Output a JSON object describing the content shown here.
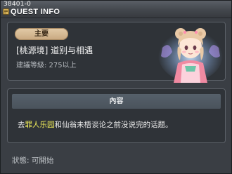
{
  "header": {
    "quest_id": "38401-0",
    "title": "QUEST INFO",
    "icon": "quest-book-icon"
  },
  "quest": {
    "type_label": "主要",
    "name": "[桃源境] 道别与相遇",
    "level_requirement": "建議等級: 275以上",
    "npc": "npc-portrait-girl-with-bun-hair"
  },
  "content": {
    "heading": "內容",
    "text_prefix": "去",
    "highlight": "罪人乐园",
    "text_suffix": "和仙翁未梧谈论之前没说完的话题。"
  },
  "status": {
    "text": "狀態: 可開始"
  },
  "colors": {
    "highlight": "#f2ee5a",
    "pill": "#d6bb93",
    "panel_bg": "#2f3338",
    "window_bg": "#3a3e44"
  }
}
